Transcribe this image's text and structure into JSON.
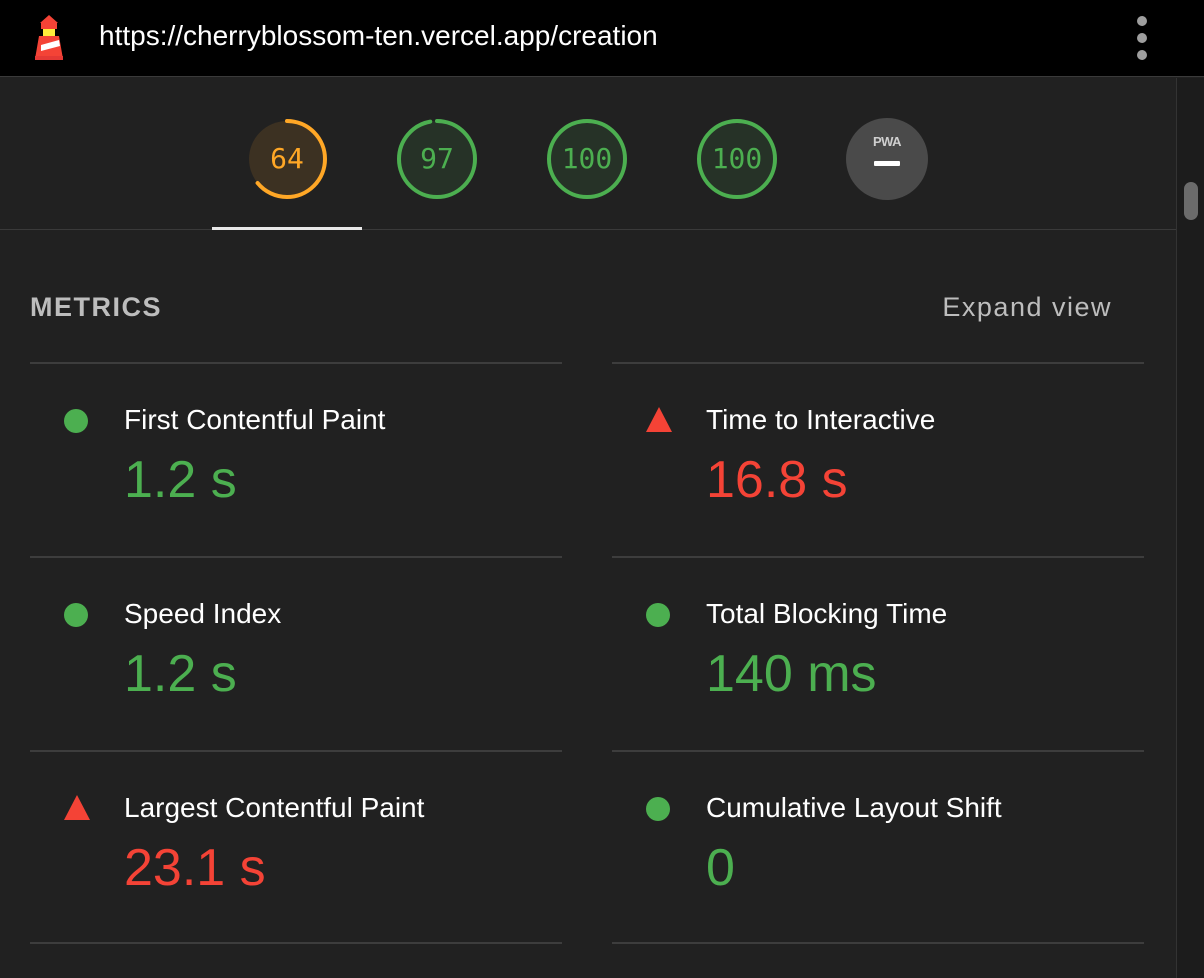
{
  "browser": {
    "url": "https://cherryblossom-ten.vercel.app/creation",
    "logo_icon": "lighthouse-icon",
    "menu_icon": "vertical-ellipsis-icon"
  },
  "gauges": [
    {
      "value": "64",
      "score": 64,
      "color": "#ffa726"
    },
    {
      "value": "97",
      "score": 97,
      "color": "#4caf50"
    },
    {
      "value": "100",
      "score": 100,
      "color": "#4caf50"
    },
    {
      "value": "100",
      "score": 100,
      "color": "#4caf50"
    }
  ],
  "pwa": {
    "label": "PWA",
    "icon": "pwa-badge-icon"
  },
  "metrics_section": {
    "title": "METRICS",
    "expand_label": "Expand view"
  },
  "metrics": [
    {
      "name": "First Contentful Paint",
      "value": "1.2 s",
      "status": "pass",
      "color": "#4caf50"
    },
    {
      "name": "Time to Interactive",
      "value": "16.8 s",
      "status": "fail",
      "color": "#f44336"
    },
    {
      "name": "Speed Index",
      "value": "1.2 s",
      "status": "pass",
      "color": "#4caf50"
    },
    {
      "name": "Total Blocking Time",
      "value": "140 ms",
      "status": "pass",
      "color": "#4caf50"
    },
    {
      "name": "Largest Contentful Paint",
      "value": "23.1 s",
      "status": "fail",
      "color": "#f44336"
    },
    {
      "name": "Cumulative Layout Shift",
      "value": "0",
      "status": "pass",
      "color": "#4caf50"
    }
  ]
}
